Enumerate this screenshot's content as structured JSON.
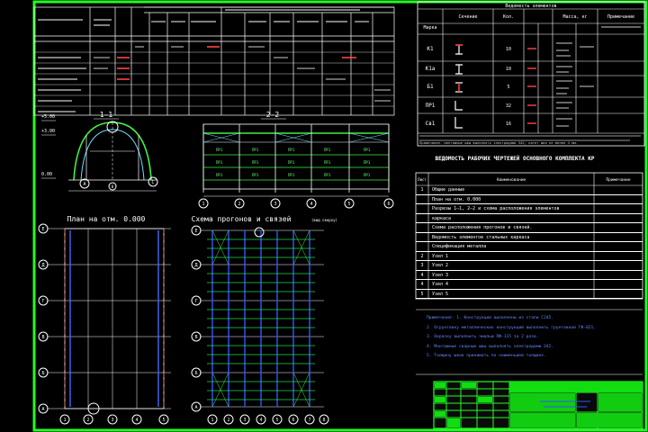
{
  "colors": {
    "background": "#000000",
    "frame": "#22ff22",
    "lines": "#ffffff",
    "grid": "#22cc44",
    "accent_red": "#ff3333",
    "accent_blue": "#3355ff",
    "accent_cyan": "#66e0ff",
    "title_fill": "#11dd11"
  },
  "drawings": {
    "section_1_1": {
      "label": "1-1",
      "elevation_top": "+5.00",
      "elevation_mid": "+3.00",
      "elevation_low": "0.00",
      "axes": [
        "A",
        "B",
        "C"
      ]
    },
    "section_2_2": {
      "label": "2-2",
      "panel_label": "ПР1",
      "axes": [
        "1",
        "2",
        "3",
        "4",
        "5",
        "6"
      ]
    },
    "plan": {
      "title": "План на отм. 0.000",
      "row_axes": [
        "Е",
        "Д",
        "Г",
        "В",
        "Б",
        "А"
      ],
      "column_axes": [
        "1",
        "2",
        "3",
        "4",
        "5"
      ]
    },
    "purlins_scheme": {
      "title": "Схема прогонов и связей",
      "subtitle": "(вид сверху)",
      "row_axes": [
        "Е",
        "Д",
        "Г",
        "В",
        "Б",
        "А"
      ],
      "column_axes": [
        "1",
        "2",
        "3",
        "4",
        "5",
        "6",
        "7",
        "8"
      ]
    }
  },
  "elements_table": {
    "title": "Ведомость элементов",
    "headers": [
      "Марка",
      "Сечение",
      "Кол.",
      "Масса, кг",
      "Примечание"
    ],
    "rows": [
      {
        "mark": "К1",
        "qty": "10"
      },
      {
        "mark": "К1а",
        "qty": "10"
      },
      {
        "mark": "Б1",
        "qty": "5"
      },
      {
        "mark": "ПР1",
        "qty": "32"
      },
      {
        "mark": "Св1",
        "qty": "16"
      }
    ]
  },
  "drawings_list": {
    "title": "ВЕДОМОСТЬ РАБОЧИХ ЧЕРТЕЖЕЙ ОСНОВНОГО КОМПЛЕКТА КР",
    "headers": [
      "Лист",
      "Наименование",
      "Примечание"
    ],
    "rows": [
      {
        "sheet": "1",
        "name": "Общие данные"
      },
      {
        "sheet": "",
        "name": "План на отм. 0.000"
      },
      {
        "sheet": "",
        "name": "Разрезы 1—1, 2—2 и схема расположения элементов"
      },
      {
        "sheet": "",
        "name": "каркаса"
      },
      {
        "sheet": "",
        "name": "Схема расположения прогонов и связей."
      },
      {
        "sheet": "",
        "name": "Ведомость элементов стальных каркаса"
      },
      {
        "sheet": "",
        "name": "Спецификация металла"
      },
      {
        "sheet": "2",
        "name": "Узел 1"
      },
      {
        "sheet": "3",
        "name": "Узел 2"
      },
      {
        "sheet": "4",
        "name": "Узел 3"
      },
      {
        "sheet": "4",
        "name": "Узел 4"
      },
      {
        "sheet": "5",
        "name": "Узел 5"
      }
    ]
  },
  "notes": [
    "Примечания: 1. Конструкции выполнены из стали С245.",
    "2. Огрунтовку металлических конструкций выполнить грунтовкой ГФ-021.",
    "3. Окраску выполнить эмалью ПФ-115 за 2 раза.",
    "4. Монтажные сварные швы выполнять электродами Э42.",
    "5. Толщину швов принимать по наименьшей толщине."
  ],
  "footnote": "Примечание: монтажные швы выполнять электродами Э42; катет шва не менее 4 мм."
}
